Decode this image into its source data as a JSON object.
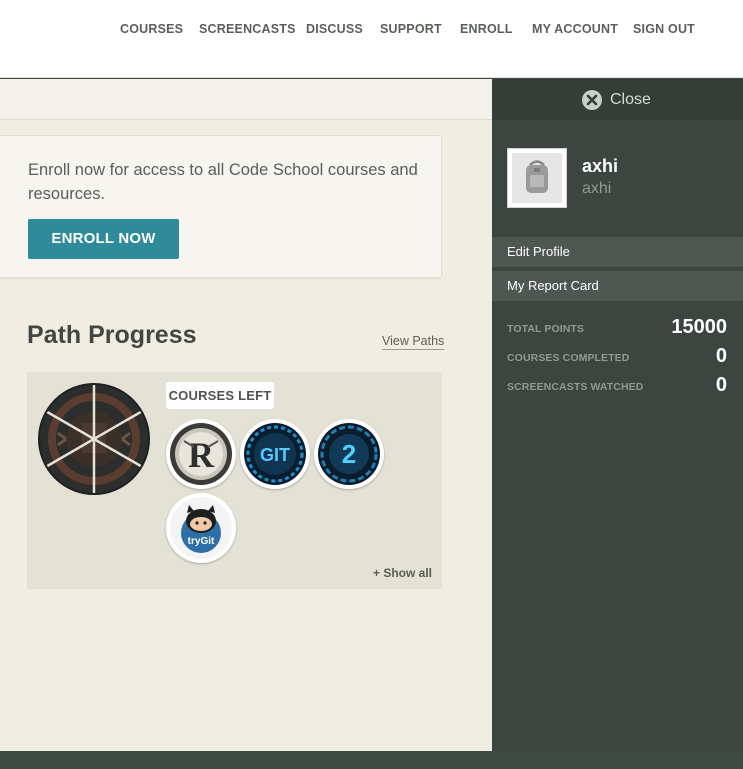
{
  "nav": {
    "items": [
      {
        "label": "COURSES"
      },
      {
        "label": "SCREENCASTS"
      },
      {
        "label": "DISCUSS"
      },
      {
        "label": "SUPPORT"
      },
      {
        "label": "ENROLL"
      },
      {
        "label": "MY ACCOUNT"
      },
      {
        "label": "SIGN OUT"
      }
    ]
  },
  "enroll": {
    "text": "Enroll now for access to all Code School courses and resources.",
    "button_label": "ENROLL NOW"
  },
  "path_progress": {
    "title": "Path Progress",
    "view_paths_label": "View Paths",
    "courses_left_label": "COURSES LEFT",
    "badges": [
      {
        "icon": "rails-for-zombies-r-badge-icon"
      },
      {
        "icon": "git-real-badge-icon"
      },
      {
        "icon": "git-real-2-badge-icon"
      },
      {
        "icon": "try-git-badge-icon",
        "label": "tryGit"
      }
    ],
    "show_all_label": "+ Show all"
  },
  "panel": {
    "close_label": "Close",
    "user": {
      "name": "axhi",
      "handle": "axhi"
    },
    "links": [
      {
        "label": "Edit Profile"
      },
      {
        "label": "My Report Card"
      }
    ],
    "stats": [
      {
        "label": "TOTAL POINTS",
        "value": "15000"
      },
      {
        "label": "COURSES COMPLETED",
        "value": "0"
      },
      {
        "label": "SCREENCASTS WATCHED",
        "value": "0"
      }
    ]
  },
  "colors": {
    "accent": "#2f8b99",
    "panel_bg": "#3d4540",
    "content_bg": "#f0ede2"
  }
}
